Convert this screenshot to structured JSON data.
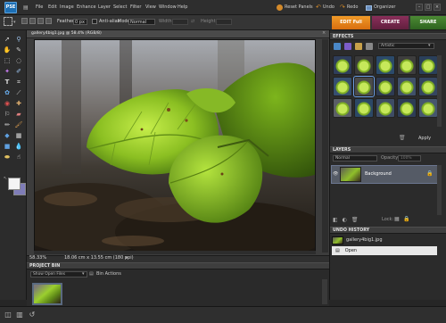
{
  "app": {
    "logo_text": "PSE",
    "menu": [
      "File",
      "Edit",
      "Image",
      "Enhance",
      "Layer",
      "Select",
      "Filter",
      "View",
      "Window",
      "Help"
    ],
    "reset_panels": "Reset Panels",
    "undo": "Undo",
    "redo": "Redo",
    "organizer": "Organizer",
    "minimize": "–",
    "maximize": "□",
    "close": "×"
  },
  "options_bar": {
    "feather_label": "Feather:",
    "feather_value": "0 px",
    "antialias_label": "Anti-alias",
    "mode_label": "Mode:",
    "mode_value": "Normal",
    "width_label": "Width:",
    "height_label": "Height:"
  },
  "mode_tabs": {
    "edit": "EDIT Full",
    "create": "CREATE",
    "share": "SHARE"
  },
  "document": {
    "tab_title": "gallery4big1.jpg @ 58.4% (RGB/8)",
    "zoom": "58.33%",
    "info": "18.06 cm x 13.55 cm (180 ppi)"
  },
  "effects": {
    "header": "EFFECTS",
    "category": "Artistic",
    "apply": "Apply",
    "thumb_count": 15
  },
  "layers": {
    "header": "LAYERS",
    "blend_mode": "Normal",
    "opacity_label": "Opacity:",
    "opacity_value": "100%",
    "layer_name": "Background",
    "lock_label": "Lock:"
  },
  "undo_history": {
    "header": "UNDO HISTORY",
    "items": [
      "gallery4big1.jpg",
      "Open"
    ]
  },
  "project_bin": {
    "header": "PROJECT BIN",
    "show_value": "Show Open Files",
    "bin_actions": "Bin Actions"
  },
  "colors": {
    "accent_edit": "#e8841c",
    "accent_create": "#7a2a50",
    "accent_share": "#3e7a2a",
    "panel_bg": "#2b2b2b"
  }
}
